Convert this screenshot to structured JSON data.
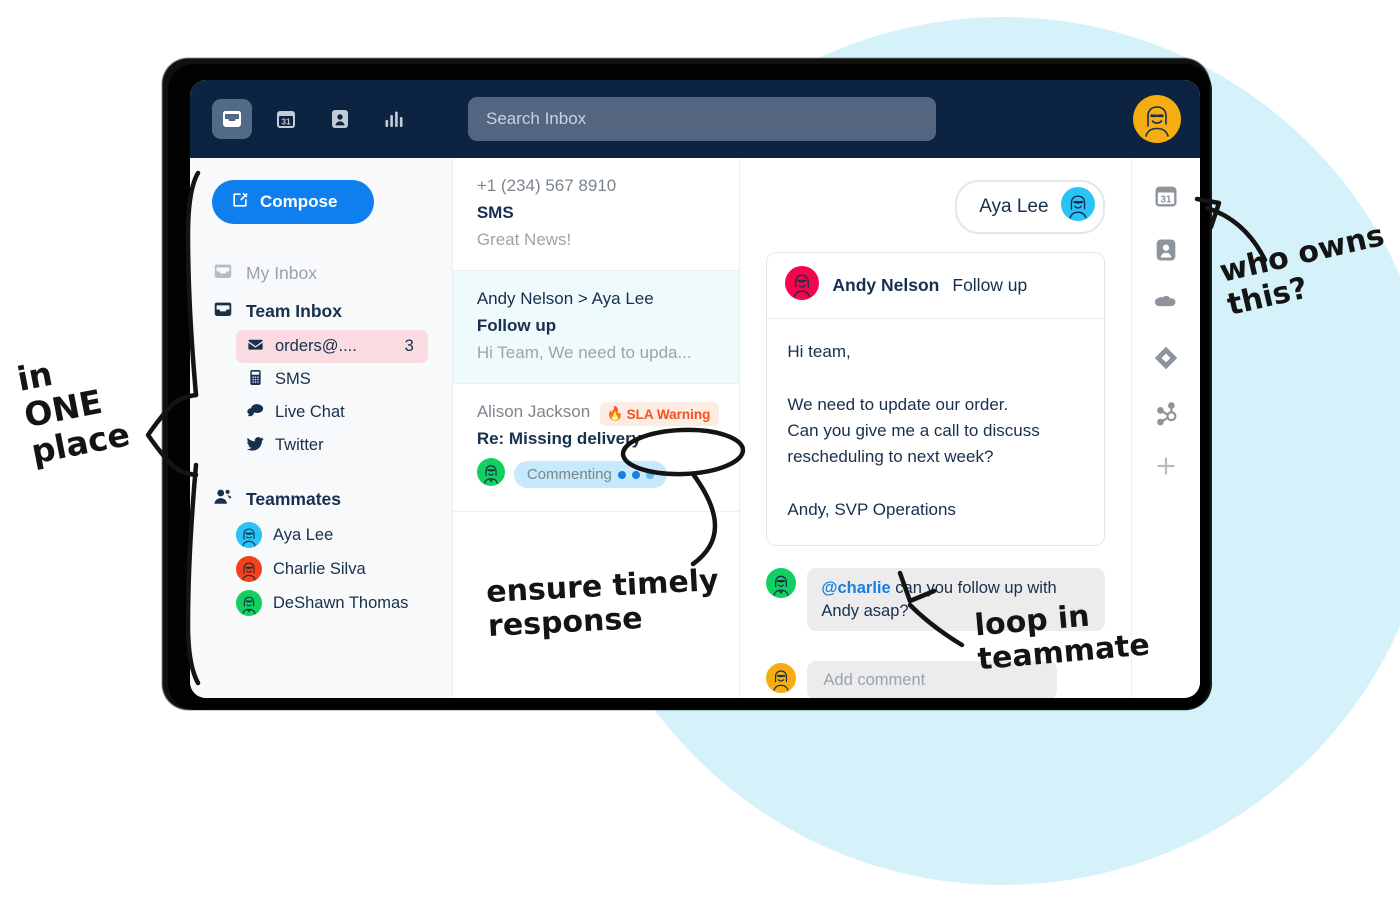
{
  "topbar": {
    "icons": [
      {
        "name": "inbox-icon",
        "label": "Inbox",
        "active": true
      },
      {
        "name": "calendar-icon",
        "label": "Calendar",
        "day": "31"
      },
      {
        "name": "contact-icon",
        "label": "Contacts"
      },
      {
        "name": "analytics-icon",
        "label": "Analytics"
      }
    ],
    "search_placeholder": "Search Inbox",
    "avatar_name": "user-avatar",
    "avatar_color": "#f5ad12",
    "background": "#0c2442"
  },
  "sidebar": {
    "compose_label": "Compose",
    "compose_color": "#0f7ff0",
    "my_inbox_label": "My Inbox",
    "team_inbox_label": "Team Inbox",
    "channels": [
      {
        "label": "orders@....",
        "count": "3",
        "icon": "envelope-icon",
        "active": true
      },
      {
        "label": "SMS",
        "count": "",
        "icon": "mobile-icon",
        "active": false
      },
      {
        "label": "Live Chat",
        "count": "",
        "icon": "chat-icon",
        "active": false
      },
      {
        "label": "Twitter",
        "count": "",
        "icon": "twitter-icon",
        "active": false
      }
    ],
    "active_channel_bg": "#fadbe1",
    "teammates_label": "Teammates",
    "teammates": [
      {
        "name": "Aya Lee",
        "color": "#29c3f5"
      },
      {
        "name": "Charlie Silva",
        "color": "#f4411b"
      },
      {
        "name": "DeShawn Thomas",
        "color": "#13cf5f"
      }
    ]
  },
  "conversations": [
    {
      "from": "+1 (234) 567 8910",
      "subject": "SMS",
      "preview": "Great News!",
      "selected": false,
      "badge": "",
      "commenting": ""
    },
    {
      "from": "Andy Nelson > Aya Lee",
      "subject": "Follow up",
      "preview": "Hi Team, We need to upda...",
      "selected": true,
      "badge": "",
      "commenting": ""
    },
    {
      "from": "Alison Jackson",
      "subject": "Re: Missing delivery",
      "preview": "",
      "selected": false,
      "badge": "SLA Warning",
      "badge_icon": "fire-icon",
      "badge_color": "#f4511e",
      "badge_bg": "#fdece4",
      "commenting": "Commenting",
      "commenting_avatar_color": "#13cf5f"
    }
  ],
  "message": {
    "assignee": "Aya Lee",
    "assignee_color": "#29c3f5",
    "sender": "Andy Nelson",
    "sender_color": "#f5044c",
    "subject": "Follow up",
    "body": "Hi team,\n\nWe need to update our order.\nCan you give me a call to discuss\nrescheduling to next week?\n\nAndy, SVP Operations",
    "comment": {
      "mention": "@charlie",
      "text": " can you follow up with Andy asap?",
      "avatar_color": "#13cf5f"
    },
    "add_comment_placeholder": "Add comment",
    "add_comment_avatar_color": "#f5ad12"
  },
  "rail": {
    "icons": [
      {
        "name": "calendar-icon",
        "label": "Calendar",
        "day": "31"
      },
      {
        "name": "contact-icon",
        "label": "Contact"
      },
      {
        "name": "salesforce-cloud-icon",
        "label": "Salesforce"
      },
      {
        "name": "jira-diamond-icon",
        "label": "Jira"
      },
      {
        "name": "hubspot-icon",
        "label": "HubSpot"
      },
      {
        "name": "plus-icon",
        "label": "Add integration"
      }
    ]
  },
  "annotations": {
    "one_place": "in\nONE\nplace",
    "timely": "ensure timely\nresponse",
    "loop_in": "loop in\nteammate",
    "who_owns": "who owns\n     this?"
  },
  "decor": {
    "circle_color": "#d5f2fb"
  }
}
